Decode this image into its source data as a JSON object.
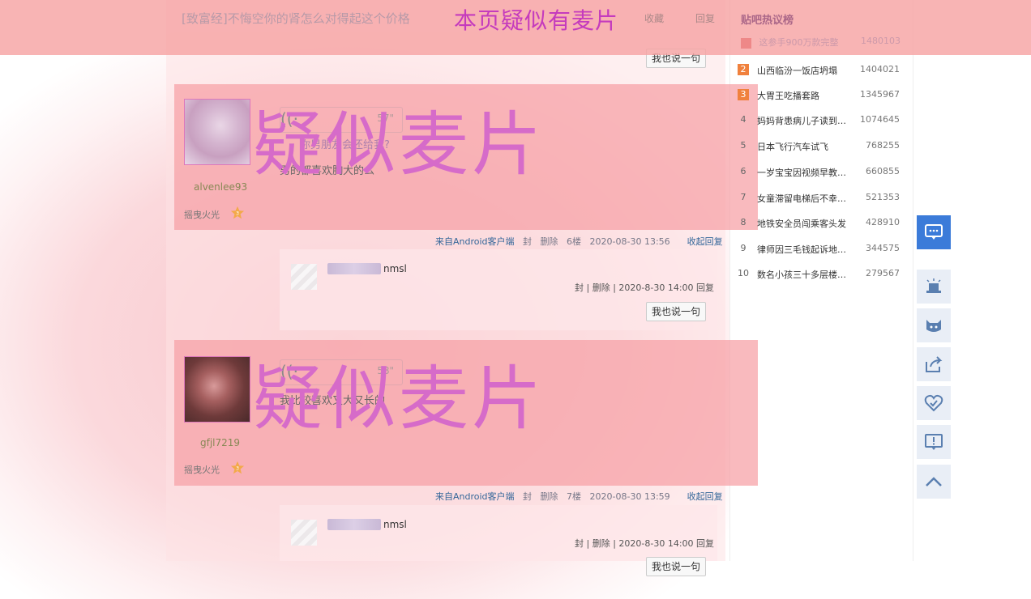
{
  "banner": {
    "thread_title": "[致富经]不悔空你的肾怎么对得起这个价格",
    "collect": "收藏",
    "reply": "回复",
    "warning": "本页疑似有麦片"
  },
  "say_button": "我也说一句",
  "posts": [
    {
      "username": "alvenlee93",
      "level_name": "摇曳火光",
      "level_num": "3",
      "voice_duration": "57\"",
      "text_blurred": "你男朋友会还给我?",
      "text": "男的都喜欢胸大的么",
      "overlay": "疑似麦片",
      "meta": {
        "source": "来自Android客户端",
        "ban": "封",
        "delete": "删除",
        "floor": "6楼",
        "time": "2020-08-30 13:56",
        "fold": "收起回复"
      },
      "reply": {
        "text": "nmsl",
        "meta": "封 | 删除 | 2020-8-30 14:00  回复"
      }
    },
    {
      "username": "gfjl7219",
      "level_name": "摇曳火光",
      "level_num": "3",
      "voice_duration": "58\"",
      "text": "我比较喜欢又大又长的",
      "overlay": "疑似麦片",
      "meta": {
        "source": "来自Android客户端",
        "ban": "封",
        "delete": "删除",
        "floor": "7楼",
        "time": "2020-08-30 13:59",
        "fold": "收起回复"
      },
      "reply": {
        "text": "nmsl",
        "meta": "封 | 删除 | 2020-8-30 14:00  回复"
      }
    }
  ],
  "hot_list": {
    "title": "贴吧热议榜",
    "items": [
      {
        "rank": "1",
        "name": "这参手900万款完整",
        "count": "1480103"
      },
      {
        "rank": "2",
        "name": "山西临汾一饭店坍塌",
        "count": "1404021"
      },
      {
        "rank": "3",
        "name": "大胃王吃播套路",
        "count": "1345967"
      },
      {
        "rank": "4",
        "name": "妈妈背患病儿子读到…",
        "count": "1074645"
      },
      {
        "rank": "5",
        "name": "日本飞行汽车试飞",
        "count": "768255"
      },
      {
        "rank": "6",
        "name": "一岁宝宝因视频早教…",
        "count": "660855"
      },
      {
        "rank": "7",
        "name": "女童滞留电梯后不幸…",
        "count": "521353"
      },
      {
        "rank": "8",
        "name": "地铁安全员闯乘客头发",
        "count": "428910"
      },
      {
        "rank": "9",
        "name": "律师因三毛钱起诉地…",
        "count": "344575"
      },
      {
        "rank": "10",
        "name": "数名小孩三十多层楼…",
        "count": "279567"
      }
    ]
  },
  "toolbar": [
    "comment-icon",
    "magic-hat-icon",
    "cat-face-icon",
    "share-icon",
    "heart-icon",
    "report-icon",
    "back-to-top-icon"
  ],
  "colors": {
    "banner": "#f6a4a4",
    "warning_text": "#c53bbd",
    "overlay_text": "#d66bc9",
    "rank_top": "#f0813d",
    "toolbar_active": "#3b7bd9"
  }
}
